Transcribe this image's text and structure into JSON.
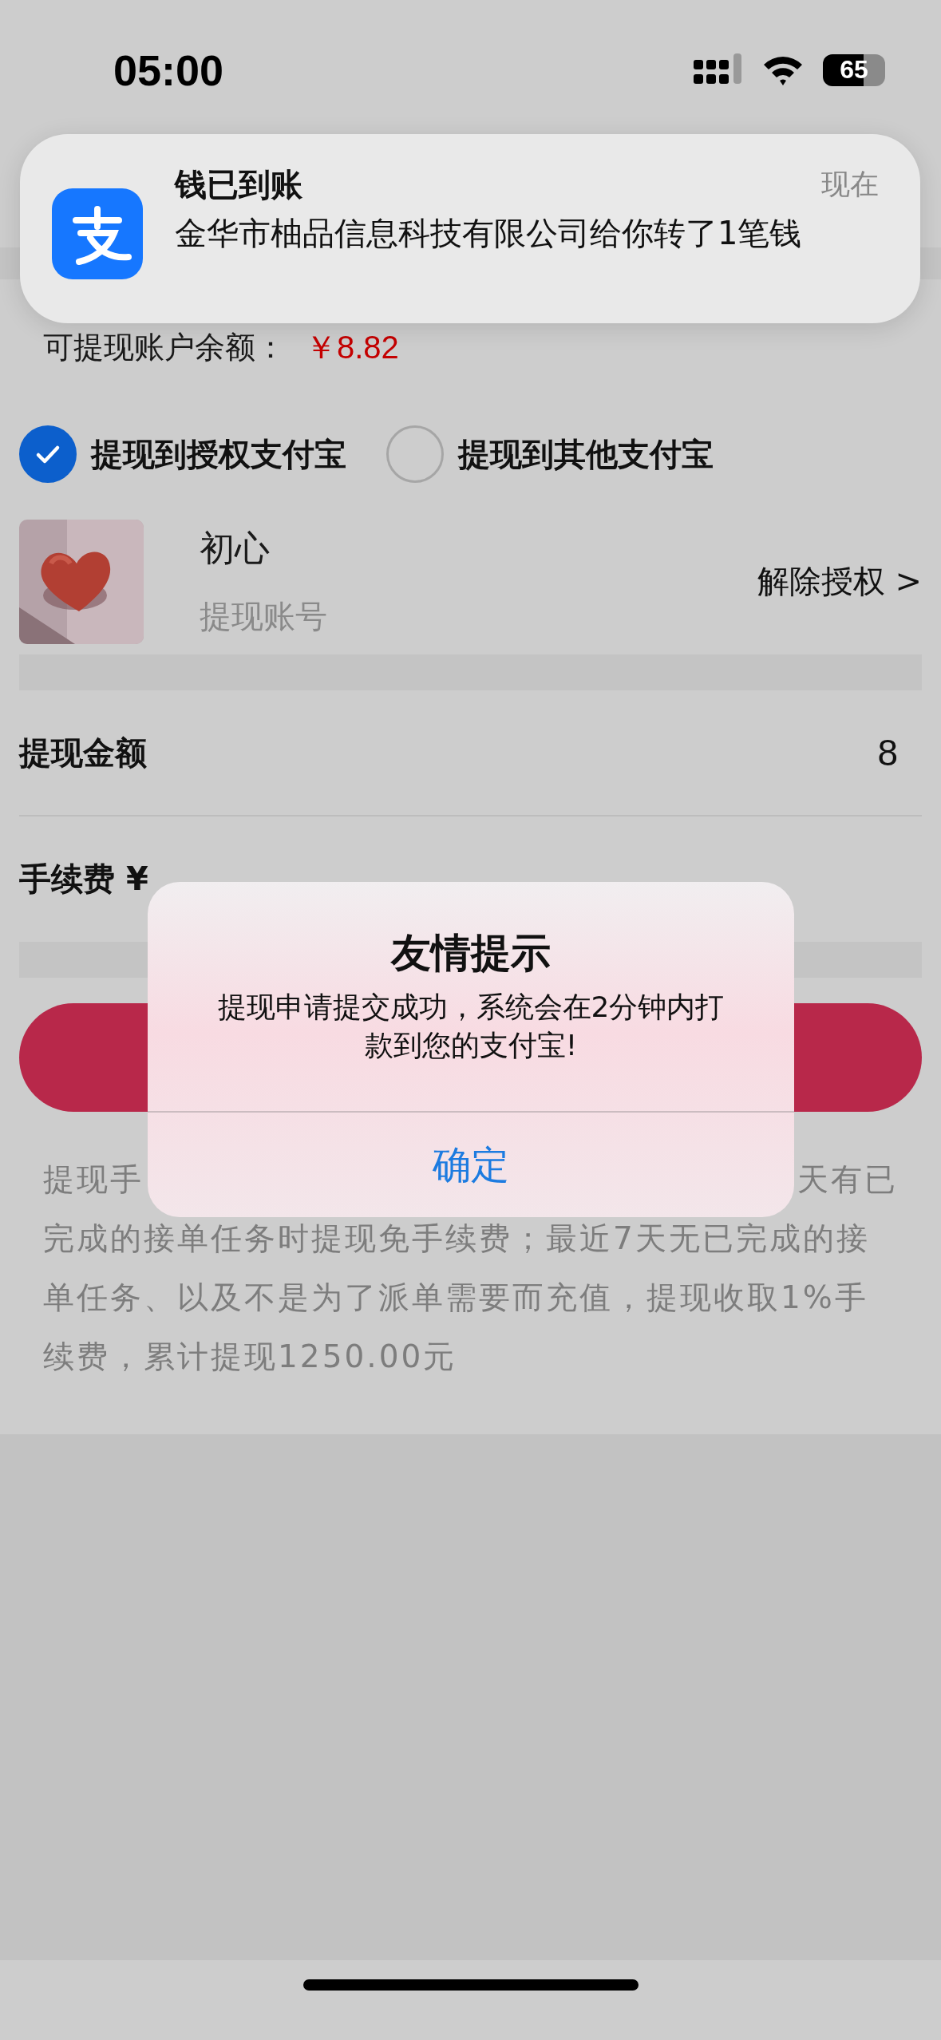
{
  "status_bar": {
    "time": "05:00",
    "battery": "65"
  },
  "notification": {
    "title": "钱已到账",
    "time": "现在",
    "message": "金华市柚品信息科技有限公司给你转了1笔钱"
  },
  "balance": {
    "label": "可提现账户余额：",
    "amount": "￥8.82"
  },
  "options": [
    {
      "label": "提现到授权支付宝",
      "selected": true
    },
    {
      "label": "提现到其他支付宝",
      "selected": false
    }
  ],
  "account": {
    "name": "初心",
    "subtitle": "提现账号",
    "action": "解除授权 >"
  },
  "amount": {
    "label": "提现金额",
    "value": "8"
  },
  "fee": {
    "label": "手续费 ¥"
  },
  "notes": {
    "line_start": "提现手",
    "line_end": "天有已",
    "rest": "完成的接单任务时提现免手续费；最近7天无已完成的接单任务、以及不是为了派单需要而充值，提现收取1%手续费，累计提现1250.00元"
  },
  "dialog": {
    "title": "友情提示",
    "message": "提现申请提交成功，系统会在2分钟内打款到您的支付宝!",
    "button": "确定"
  }
}
